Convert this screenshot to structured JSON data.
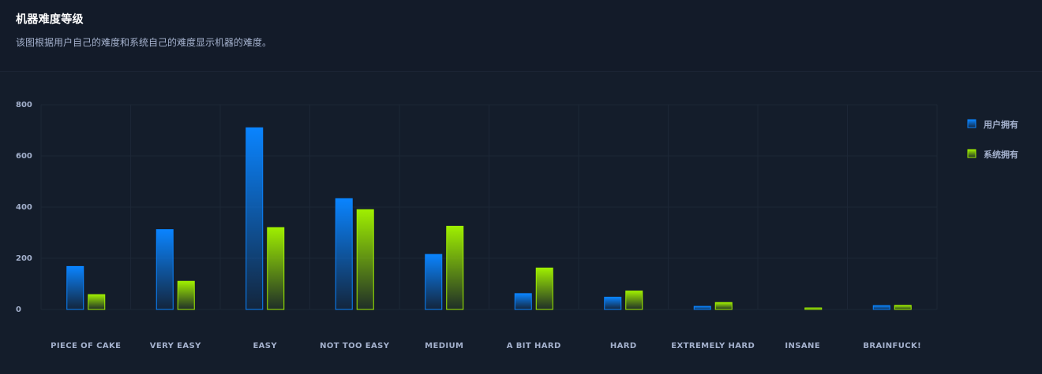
{
  "header": {
    "title": "机器难度等级",
    "subtitle": "该图根据用户自己的难度和系统自己的难度显示机器的难度。"
  },
  "colors": {
    "background": "#141d2b",
    "grid": "#1c2636",
    "text": "#a4b1cd",
    "user_series": "#0a84ff",
    "system_series": "#9fef00"
  },
  "chart_data": {
    "type": "bar",
    "title": "机器难度等级",
    "categories": [
      "PIECE OF CAKE",
      "VERY EASY",
      "EASY",
      "NOT TOO EASY",
      "MEDIUM",
      "A BIT HARD",
      "HARD",
      "EXTREMELY HARD",
      "INSANE",
      "BRAINFUCK!"
    ],
    "series": [
      {
        "name": "用户拥有",
        "values": [
          168,
          312,
          710,
          433,
          215,
          62,
          48,
          12,
          0,
          15
        ]
      },
      {
        "name": "系统拥有",
        "values": [
          58,
          110,
          320,
          390,
          325,
          162,
          72,
          27,
          6,
          16
        ]
      }
    ],
    "ylim": [
      0,
      800
    ],
    "yticks": [
      0,
      200,
      400,
      600,
      800
    ],
    "grid": true,
    "legend": "right"
  }
}
